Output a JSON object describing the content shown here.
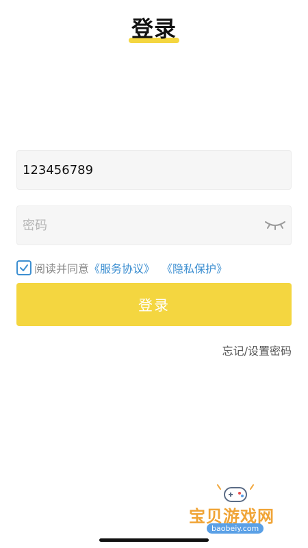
{
  "header": {
    "title": "登录"
  },
  "form": {
    "phone": {
      "value": "123456789",
      "placeholder": ""
    },
    "password": {
      "value": "",
      "placeholder": "密码",
      "toggle_icon": "eye-closed-icon"
    },
    "agreement": {
      "checked": true,
      "prefix": "阅读并同意",
      "terms_link": "《服务协议》",
      "privacy_link": "《隐私保护》"
    },
    "login_button": "登录",
    "forgot_link": "忘记/设置密码"
  },
  "watermark": {
    "brand": "宝贝游戏网",
    "url": "baobeiy.com",
    "icon": "gamepad-icon"
  },
  "colors": {
    "accent": "#f4d640",
    "link": "#3d8fd1",
    "watermark": "#f0a436"
  }
}
